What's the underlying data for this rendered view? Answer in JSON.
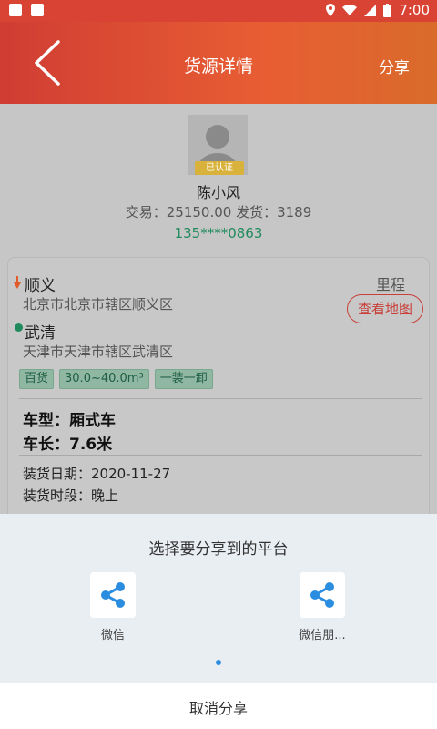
{
  "status_bar": {
    "time": "7:00"
  },
  "header": {
    "title": "货源详情",
    "share_label": "分享"
  },
  "profile": {
    "name": "陈小风",
    "verified_badge": "已认证",
    "stats": "交易：25150.00  发货：3189",
    "phone": "135****0863"
  },
  "route": {
    "from_city": "顺义",
    "from_address": "北京市北京市辖区顺义区",
    "to_city": "武清",
    "to_address": "天津市天津市辖区武清区",
    "mileage_label": "里程",
    "map_button": "查看地图"
  },
  "tags": [
    "百货",
    "30.0~40.0m³",
    "一装一卸"
  ],
  "truck": {
    "type": "车型：厢式车",
    "length": "车长：7.6米"
  },
  "loading": {
    "date": "装货日期：2020-11-27",
    "time_slot": "装货时段：晚上"
  },
  "share_sheet": {
    "prompt": "选择要分享到的平台",
    "platforms": [
      {
        "label": "微信",
        "icon": "share-icon"
      },
      {
        "label": "微信朋...",
        "icon": "share-icon"
      }
    ],
    "cancel": "取消分享"
  },
  "colors": {
    "header_start": "#cf3d33",
    "header_end": "#d96b2b",
    "accent_green": "#1f8a5b",
    "accent_red": "#c9403a",
    "share_blue": "#2b8de0"
  }
}
